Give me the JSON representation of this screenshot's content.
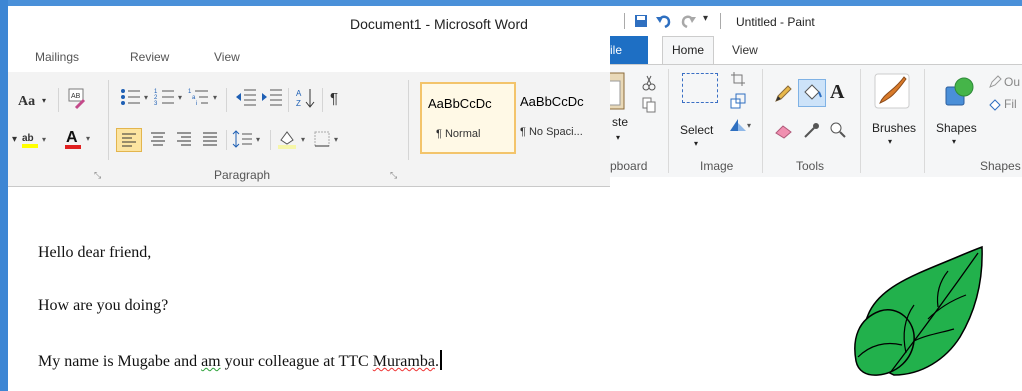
{
  "word": {
    "title": "Document1 - Microsoft Word",
    "tabs": [
      "Mailings",
      "Review",
      "View"
    ],
    "font_group": {
      "change_case": "Aa"
    },
    "paragraph_label": "Paragraph",
    "styles": [
      {
        "sample": "AaBbCcDc",
        "name": "¶ Normal"
      },
      {
        "sample": "AaBbCcDc",
        "name": "¶ No Spaci..."
      }
    ],
    "document_lines": [
      "Hello dear friend,",
      "How are you doing?"
    ],
    "line3": {
      "part1": "My name is Mugabe and ",
      "am": "am",
      "part2": " your colleague at TTC ",
      "muramba": "Muramba",
      "end": "."
    }
  },
  "paint": {
    "title": "Untitled - Paint",
    "file_tab": "ile",
    "home_tab": "Home",
    "view_tab": "View",
    "clipboard": {
      "paste": "ste",
      "label": "pboard"
    },
    "image": {
      "select": "Select",
      "label": "Image"
    },
    "tools": {
      "label": "Tools",
      "text_tool": "A"
    },
    "brushes": "Brushes",
    "shapes": {
      "button": "Shapes",
      "label": "Shapes",
      "outline": "Ou",
      "fill": "Fil"
    },
    "leaf_color": "#22b14c"
  }
}
